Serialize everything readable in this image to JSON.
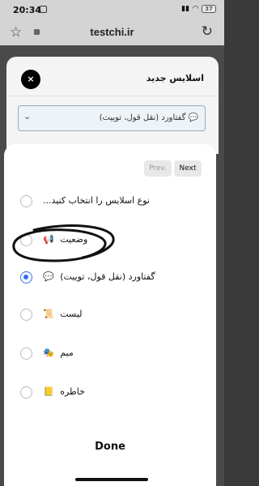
{
  "status_bar": {
    "time": "20:34",
    "battery": "37"
  },
  "browser": {
    "url": "testchi.ir"
  },
  "modal": {
    "close_label": "×",
    "title": "اسلایس جدید",
    "select_value": "💬 گفتاورد (نقل قول، توییت)"
  },
  "picker": {
    "prev_label": "Prev.",
    "next_label": "Next",
    "done_label": "Done",
    "selected_index": 2,
    "options": [
      {
        "label": "نوع اسلایس را انتخاب کنید...",
        "icon": ""
      },
      {
        "label": "وضعیت",
        "icon": "📢"
      },
      {
        "label": "گفتاورد (نقل قول، توییت)",
        "icon": "💬"
      },
      {
        "label": "لیست",
        "icon": "📜"
      },
      {
        "label": "میم",
        "icon": "🎭"
      },
      {
        "label": "خاطره",
        "icon": "📒"
      }
    ]
  },
  "colors": {
    "accent": "#2f6df6",
    "select_border": "#99aabb"
  }
}
